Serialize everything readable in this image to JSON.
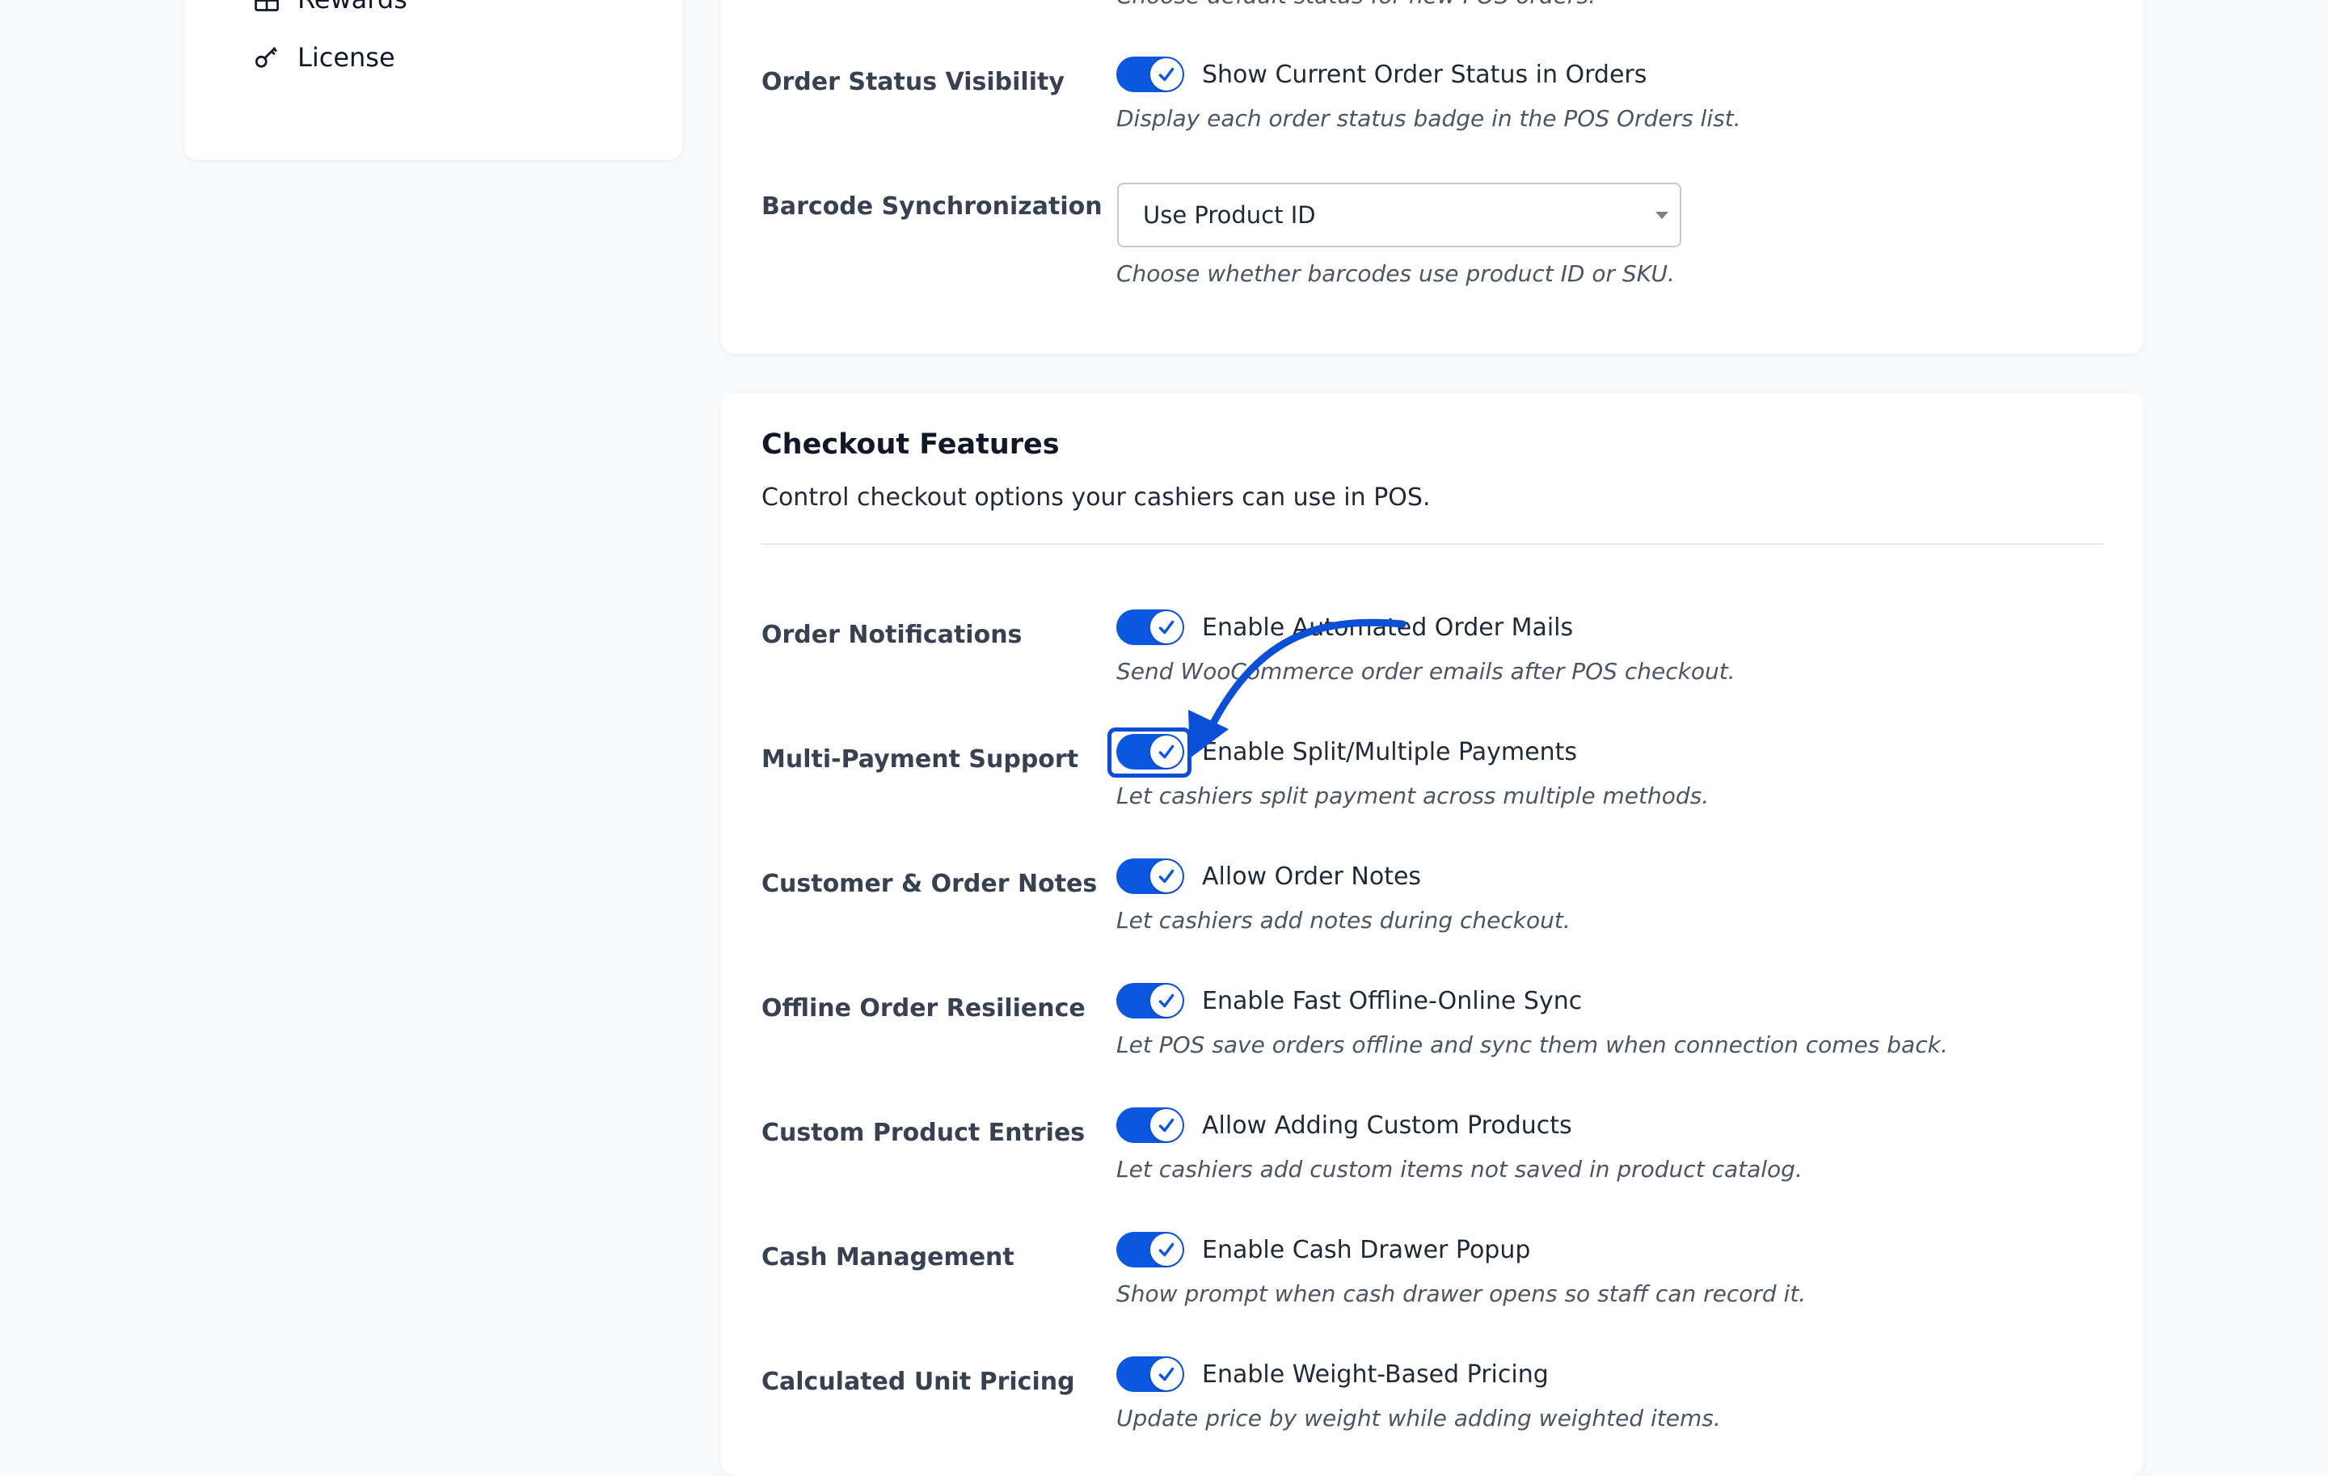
{
  "sidebar": {
    "items": [
      {
        "label": "Rewards",
        "icon": "gift-icon"
      },
      {
        "label": "License",
        "icon": "key-icon"
      }
    ]
  },
  "general": {
    "truncated_description": "Choose default status for new POS orders.",
    "order_status_visibility": {
      "label": "Order Status Visibility",
      "toggle_label": "Show Current Order Status in Orders",
      "enabled": true,
      "help": "Display each order status badge in the POS Orders list."
    },
    "barcode_sync": {
      "label": "Barcode Synchronization",
      "selected": "Use Product ID",
      "help": "Choose whether barcodes use product ID or SKU."
    }
  },
  "checkout": {
    "title": "Checkout Features",
    "description": "Control checkout options your cashiers can use in POS.",
    "rows": [
      {
        "label": "Order Notifications",
        "toggle_label": "Enable Automated Order Mails",
        "help": "Send WooCommerce order emails after POS checkout.",
        "enabled": true
      },
      {
        "label": "Multi-Payment Support",
        "toggle_label": "Enable Split/Multiple Payments",
        "help": "Let cashiers split payment across multiple methods.",
        "enabled": true
      },
      {
        "label": "Customer & Order Notes",
        "toggle_label": "Allow Order Notes",
        "help": "Let cashiers add notes during checkout.",
        "enabled": true
      },
      {
        "label": "Offline Order Resilience",
        "toggle_label": "Enable Fast Offline-Online Sync",
        "help": "Let POS save orders offline and sync them when connection comes back.",
        "enabled": true
      },
      {
        "label": "Custom Product Entries",
        "toggle_label": "Allow Adding Custom Products",
        "help": "Let cashiers add custom items not saved in product catalog.",
        "enabled": true
      },
      {
        "label": "Cash Management",
        "toggle_label": "Enable Cash Drawer Popup",
        "help": "Show prompt when cash drawer opens so staff can record it.",
        "enabled": true
      },
      {
        "label": "Calculated Unit Pricing",
        "toggle_label": "Enable Weight-Based Pricing",
        "help": "Update price by weight while adding weighted items.",
        "enabled": true
      }
    ]
  },
  "annotation": {
    "highlighted_row": "Multi-Payment Support",
    "color": "#0b4fd6"
  },
  "colors": {
    "toggle_on": "#0b57e0",
    "page_bg": "#f8f9fb",
    "card_bg": "#ffffff"
  }
}
